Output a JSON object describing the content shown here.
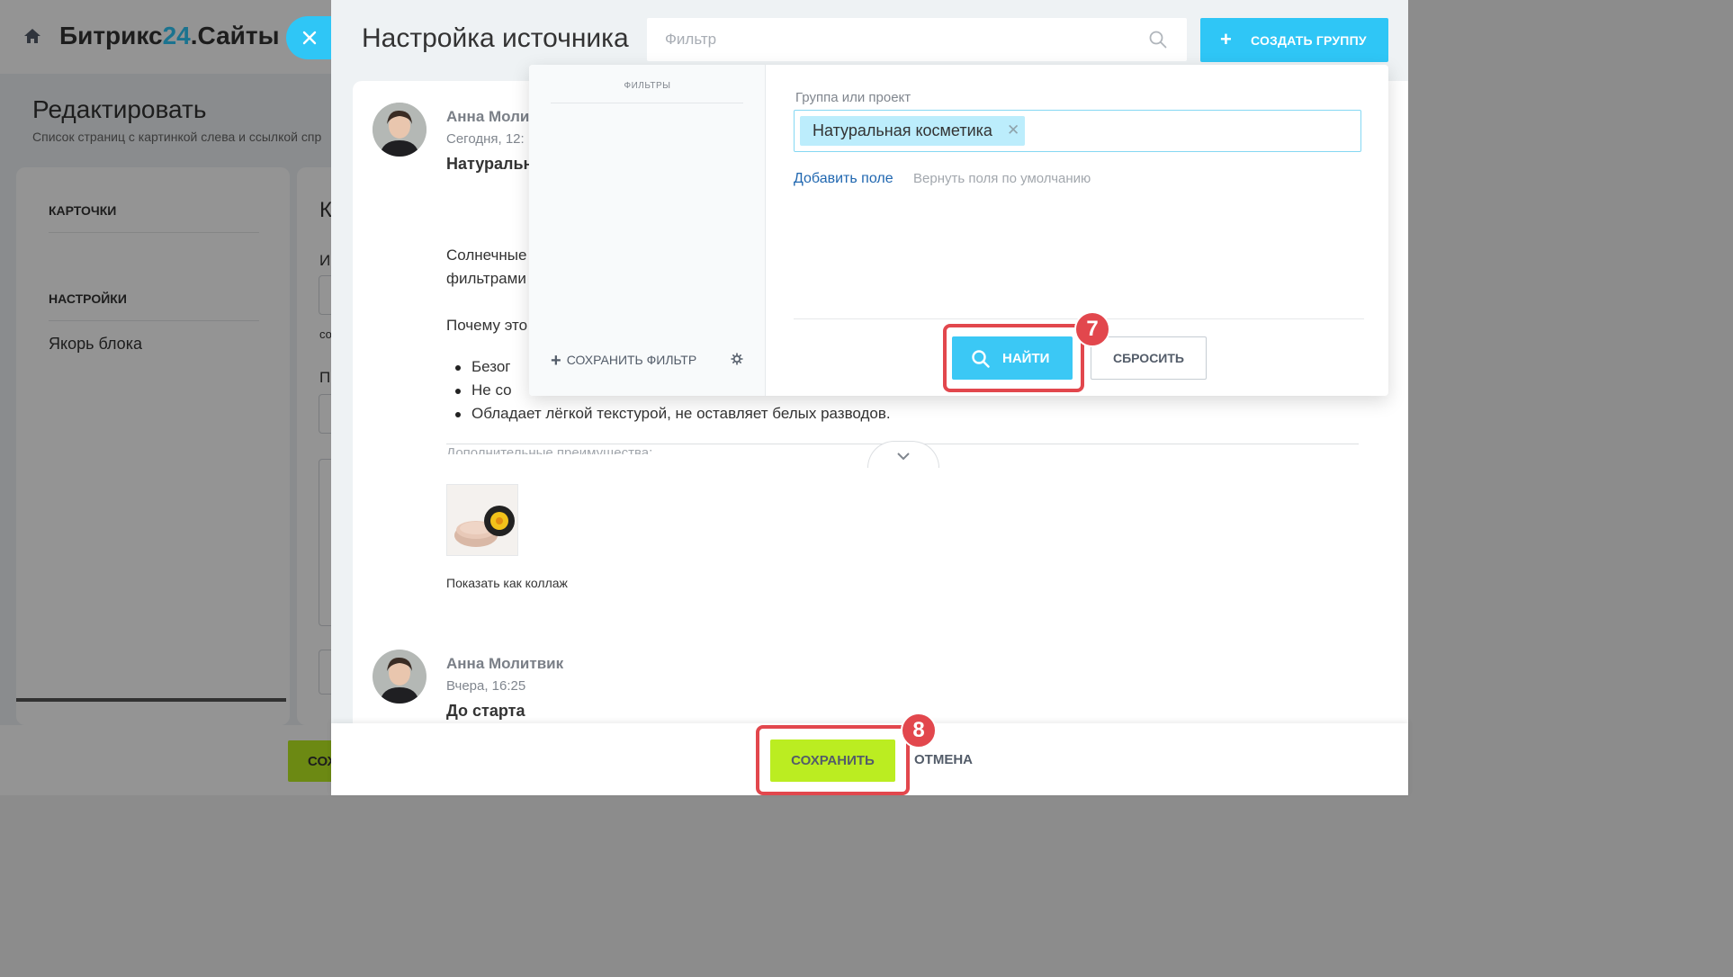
{
  "background": {
    "logo": {
      "prefix": "Битрикс",
      "number": "24",
      "suffix": ".Сайты"
    },
    "page_title": "Редактировать",
    "page_subtitle": "Список страниц с картинкой слева и ссылкой спр",
    "nav": [
      {
        "label": "КАРТОЧКИ"
      },
      {
        "label": "НАСТРОЙКИ"
      },
      {
        "label": "Якорь блока"
      }
    ],
    "right_fragments": {
      "heading": "К",
      "label1": "И",
      "label2": "со",
      "label3": "П"
    },
    "footer_save_fragment": "СОХ"
  },
  "slider": {
    "title": "Настройка источника",
    "search": {
      "placeholder": "Фильтр",
      "value": ""
    },
    "create_group_label": "СОЗДАТЬ ГРУППУ"
  },
  "filter_popup": {
    "sidebar_heading": "ФИЛЬТРЫ",
    "save_filter_label": "СОХРАНИТЬ ФИЛЬТР",
    "field_label": "Группа или проект",
    "selected_tag": "Натуральная косметика",
    "add_field": "Добавить поле",
    "restore_fields": "Вернуть поля по умолчанию",
    "find_label": "НАЙТИ",
    "reset_label": "СБРОСИТЬ"
  },
  "posts": [
    {
      "author": "Анна Моли",
      "time": "Сегодня, 12:",
      "title": "Натуральн",
      "text_line1": "Солнечные",
      "text_line2": "фильтрами",
      "text_line3": "Почему это",
      "bullets": [
        "Безог",
        "Не со",
        "Обладает лёгкой текстурой, не оставляет белых разводов."
      ],
      "more_label": "Дополнительные преимущества:",
      "collage_link": "Показать как коллаж"
    },
    {
      "author": "Анна Молитвик",
      "time": "Вчера, 16:25",
      "title": "До старта"
    }
  ],
  "footer": {
    "save_label": "СОХРАНИТЬ",
    "cancel_label": "ОТМЕНА"
  },
  "steps": {
    "find_step": "7",
    "save_step": "8"
  },
  "colors": {
    "accent_blue": "#2fc6f6",
    "save_green": "#bbed21",
    "highlight_red": "#e2474d",
    "tag_bg": "#bcedfc"
  }
}
